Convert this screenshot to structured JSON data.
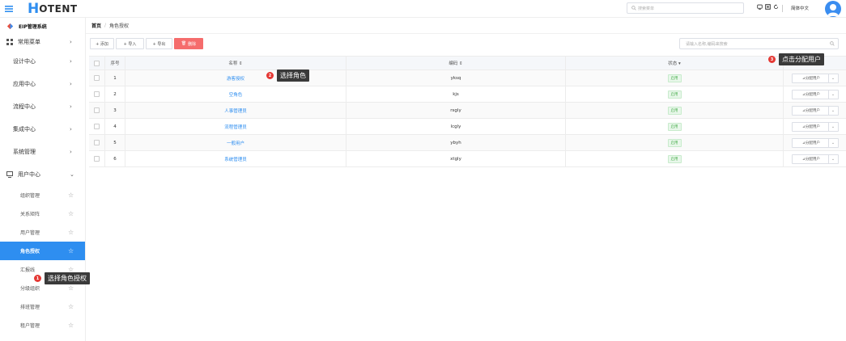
{
  "header": {
    "logo_letter": "H",
    "logo_rest": "OTENT",
    "search_placeholder": "搜索菜单",
    "lang": "简体中文"
  },
  "sidebar": {
    "system_title": "EIP管理系统",
    "common": "常用菜单",
    "items": [
      "设计中心",
      "应用中心",
      "流程中心",
      "集成中心",
      "系统管理"
    ],
    "user_center": "用户中心",
    "sub_items": [
      "组织管理",
      "关系矩阵",
      "用户管理",
      "角色授权",
      "汇报线",
      "分级组织",
      "排班管理",
      "租户管理",
      "系统"
    ]
  },
  "breadcrumb": {
    "home": "首页",
    "current": "角色授权"
  },
  "toolbar": {
    "add": "+ 添加",
    "import": "+ 导入",
    "export": "+ 导出",
    "delete": "删除",
    "search_placeholder": "请输入名称,编码来搜索"
  },
  "table": {
    "headers": {
      "no": "序号",
      "name": "名称 ⇕",
      "code": "编码 ⇕",
      "status": "状态 ▾"
    },
    "rows": [
      {
        "no": "1",
        "name": "游客授权",
        "code": "yksq",
        "status": "启用",
        "op": "分配用户"
      },
      {
        "no": "2",
        "name": "空角色",
        "code": "kjs",
        "status": "启用",
        "op": "分配用户"
      },
      {
        "no": "3",
        "name": "人事管理员",
        "code": "rsgly",
        "status": "启用",
        "op": "分配用户"
      },
      {
        "no": "4",
        "name": "流程管理员",
        "code": "lcgly",
        "status": "启用",
        "op": "分配用户"
      },
      {
        "no": "5",
        "name": "一般用户",
        "code": "ybyh",
        "status": "启用",
        "op": "分配用户"
      },
      {
        "no": "6",
        "name": "系统管理员",
        "code": "xtgly",
        "status": "启用",
        "op": "分配用户"
      }
    ]
  },
  "tips": {
    "t1": {
      "num": "1",
      "text": "选择角色授权"
    },
    "t2": {
      "num": "2",
      "text": "选择角色"
    },
    "t3": {
      "num": "3",
      "text": "点击分配用户"
    }
  }
}
